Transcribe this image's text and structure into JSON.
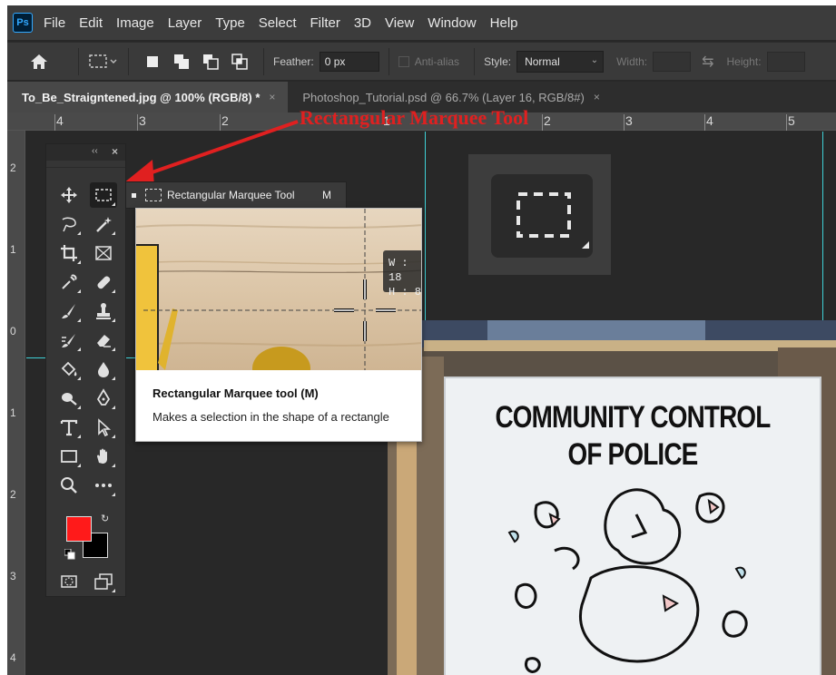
{
  "app": {
    "logo_text": "Ps"
  },
  "menu": [
    "File",
    "Edit",
    "Image",
    "Layer",
    "Type",
    "Select",
    "Filter",
    "3D",
    "View",
    "Window",
    "Help"
  ],
  "options_bar": {
    "feather_label": "Feather:",
    "feather_value": "0 px",
    "antialias_label": "Anti-alias",
    "style_label": "Style:",
    "style_value": "Normal",
    "width_label": "Width:",
    "height_label": "Height:"
  },
  "tabs": [
    {
      "label": "To_Be_Straigntened.jpg @ 100% (RGB/8) *",
      "close": "×"
    },
    {
      "label": "Photoshop_Tutorial.psd @ 66.7% (Layer 16, RGB/8#)",
      "close": "×"
    }
  ],
  "ruler_top_labels": [
    "4",
    "3",
    "2",
    "1",
    "2",
    "3",
    "4",
    "5"
  ],
  "ruler_left_labels": [
    "2",
    "1",
    "0",
    "1",
    "2",
    "3",
    "4"
  ],
  "annotation": "Rectangular Marquee Tool",
  "toolbar": {
    "collapse": "‹‹",
    "close": "×",
    "tools": [
      "move-icon",
      "rectangular-marquee-icon",
      "lasso-icon",
      "magic-wand-icon",
      "crop-icon",
      "frame-icon",
      "eyedropper-icon",
      "healing-brush-icon",
      "brush-icon",
      "clone-stamp-icon",
      "history-brush-icon",
      "eraser-icon",
      "paint-bucket-icon",
      "blur-icon",
      "dodge-icon",
      "pen-icon",
      "type-icon",
      "path-selection-icon",
      "rectangle-shape-icon",
      "hand-icon",
      "zoom-icon",
      "more-tools-icon",
      "quick-mask-icon",
      "screen-mode-icon"
    ],
    "foreground_color": "#ff1a1a",
    "background_color": "#000000"
  },
  "flyout": {
    "label": "Rectangular Marquee Tool",
    "shortcut": "M"
  },
  "tooltip": {
    "title": "Rectangular Marquee tool (M)",
    "description": "Makes a selection in the shape of a rectangle",
    "wh_w": "W : 18",
    "wh_h": "H :  8"
  },
  "sign": {
    "line1": "COMMUNITY CONTROL",
    "line2": "OF POLICE"
  },
  "colors": {
    "accent_ps": "#31a8ff",
    "guide": "#3fd0d6",
    "annotation": "#e02020"
  }
}
